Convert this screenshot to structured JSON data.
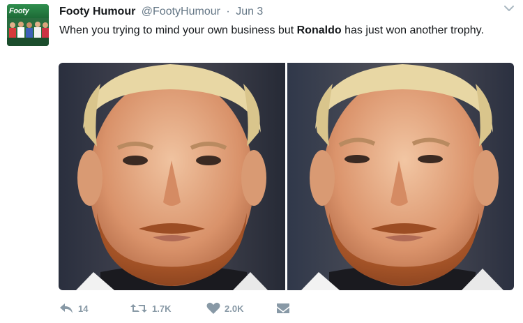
{
  "tweet": {
    "avatar_text": "Footy",
    "name": "Footy Humour",
    "handle": "@FootyHumour",
    "separator": "·",
    "date": "Jun 3",
    "text_before": "When you trying to mind your own business but ",
    "text_bold": "Ronaldo",
    "text_after": " has just won another trophy."
  },
  "actions": {
    "replies": "14",
    "retweets": "1.7K",
    "likes": "2.0K"
  },
  "icons": {
    "reply": "reply-icon",
    "retweet": "retweet-icon",
    "like": "heart-icon",
    "message": "direct-message-icon",
    "caret": "chevron-down-icon"
  },
  "colors": {
    "text": "#14171a",
    "muted": "#657786",
    "action": "#8899a6"
  }
}
